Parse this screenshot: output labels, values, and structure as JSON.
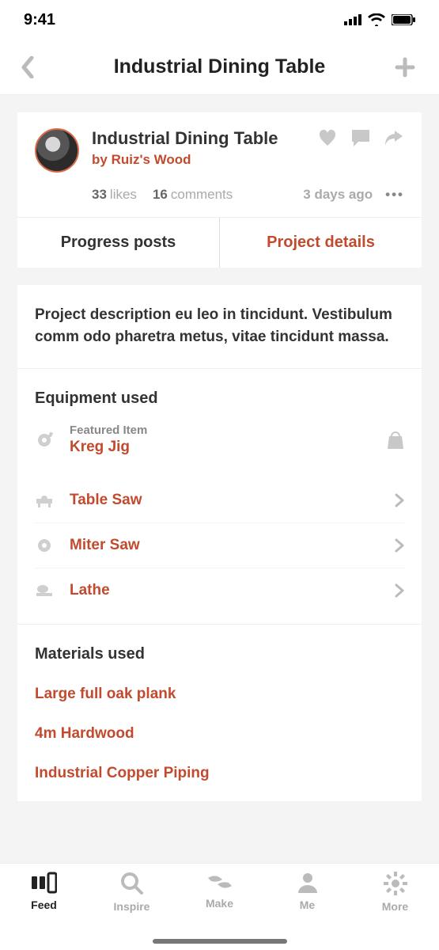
{
  "status": {
    "time": "9:41"
  },
  "nav": {
    "title": "Industrial Dining Table"
  },
  "post": {
    "title": "Industrial Dining Table",
    "author_prefix": "by ",
    "author": "Ruiz's Wood",
    "likes_count": "33",
    "likes_label": "likes",
    "comments_count": "16",
    "comments_label": "comments",
    "ago": "3 days ago"
  },
  "tabs": {
    "progress": "Progress posts",
    "details": "Project details"
  },
  "description": "Project description eu leo in tincidunt. Vestibulum comm odo pharetra metus, vitae tincidunt massa.",
  "equipment": {
    "title": "Equipment used",
    "featured_label": "Featured Item",
    "featured_name": "Kreg Jig",
    "items": [
      {
        "name": "Table Saw"
      },
      {
        "name": "Miter Saw"
      },
      {
        "name": "Lathe"
      }
    ]
  },
  "materials": {
    "title": "Materials used",
    "items": [
      {
        "name": "Large full oak plank"
      },
      {
        "name": "4m Hardwood"
      },
      {
        "name": "Industrial Copper Piping"
      }
    ]
  },
  "bottom_nav": {
    "feed": "Feed",
    "inspire": "Inspire",
    "make": "Make",
    "me": "Me",
    "more": "More"
  }
}
